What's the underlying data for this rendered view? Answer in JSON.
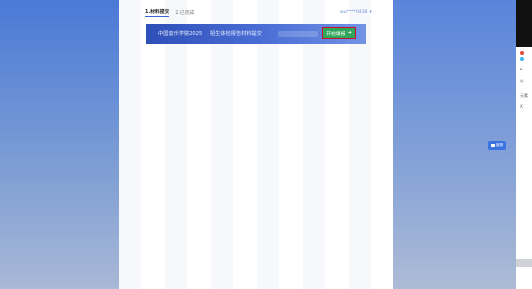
{
  "tabs": [
    {
      "label": "1.材料提交",
      "active": true
    },
    {
      "label": "2.已完成",
      "active": false
    }
  ],
  "user": {
    "name": "wu****0436",
    "dropdown_icon": "chevron-down-icon"
  },
  "banner": {
    "school": "中国音乐学院2025",
    "title": "招生体检报告材料提交"
  },
  "start_button": {
    "label": "开始填报",
    "icon": "arrow-right-icon"
  },
  "float_badge": {
    "label": "客服",
    "icon": "chat-icon"
  },
  "side_panel": {
    "items": [
      {
        "icon": "home-icon"
      },
      {
        "icon": "refresh-icon"
      },
      {
        "label": "元素"
      },
      {
        "label": "X"
      }
    ]
  },
  "colors": {
    "primary": "#3a66d6",
    "button_green": "#2fa75a",
    "highlight_red": "#c8102e"
  }
}
